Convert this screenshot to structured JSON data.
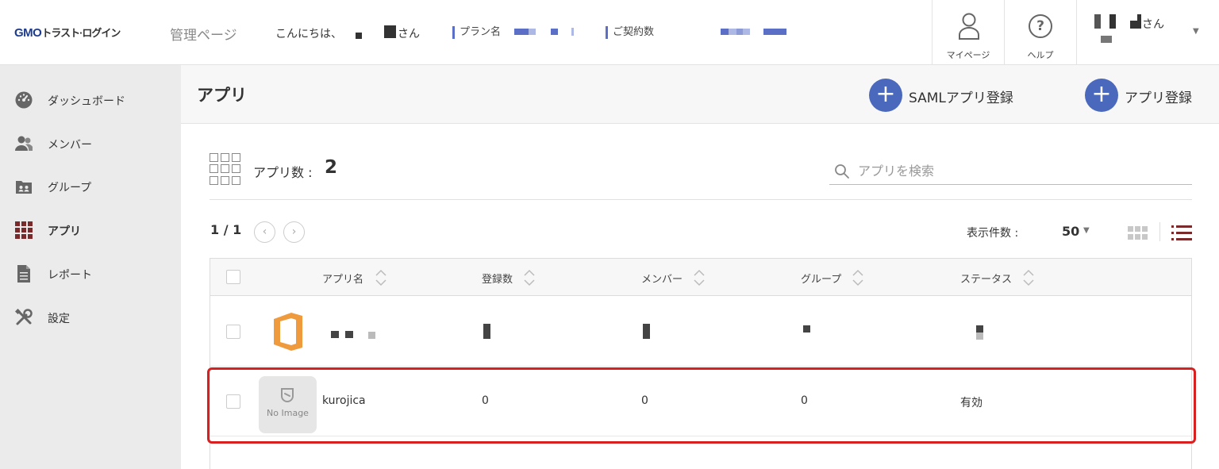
{
  "header": {
    "logo_brand": "GMO",
    "logo_rest": "トラスト·ログイン",
    "admin_label": "管理ページ",
    "greeting": "こんにちは、",
    "greeting_suffix": "さん",
    "plan_label": "プラン名",
    "contracts_label": "ご契約数",
    "mypage_label": "マイページ",
    "help_label": "ヘルプ",
    "user_suffix": "さん"
  },
  "sidebar": {
    "items": [
      {
        "label": "ダッシュボード"
      },
      {
        "label": "メンバー"
      },
      {
        "label": "グループ"
      },
      {
        "label": "アプリ"
      },
      {
        "label": "レポート"
      },
      {
        "label": "設定"
      }
    ]
  },
  "page": {
    "title": "アプリ",
    "saml_button": "SAMLアプリ登録",
    "add_button": "アプリ登録",
    "count_label": "アプリ数 :",
    "count_value": "2",
    "search_placeholder": "アプリを検索",
    "pager": "1 / 1",
    "perpage_label": "表示件数 :",
    "perpage_value": "50"
  },
  "table": {
    "columns": [
      "アプリ名",
      "登録数",
      "メンバー",
      "グループ",
      "ステータス"
    ],
    "rows": [
      {
        "name": "",
        "registered": "",
        "members": "",
        "groups": "",
        "status": ""
      },
      {
        "name": "kurojica",
        "image_label": "No Image",
        "registered": "0",
        "members": "0",
        "groups": "0",
        "status": "有効"
      }
    ]
  },
  "colors": {
    "accent": "#4a69bd",
    "highlight": "#d92020",
    "active_nav": "#7a2a2a",
    "office_icon": "#f09a3e"
  }
}
